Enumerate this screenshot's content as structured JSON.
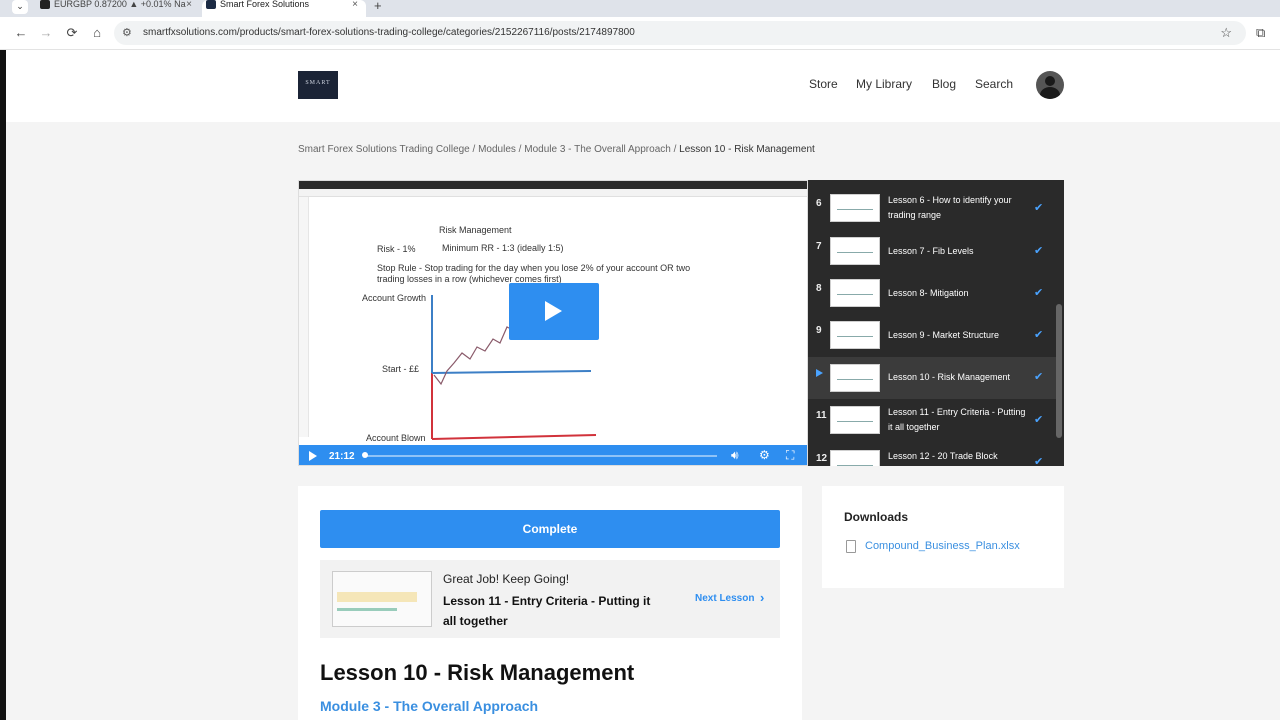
{
  "browser": {
    "tabs": [
      {
        "title": "EURGBP 0.87200 ▲ +0.01% Na",
        "active": false
      },
      {
        "title": "Smart Forex Solutions",
        "active": true
      }
    ],
    "new_tab": "+",
    "close_glyph": "×",
    "url": "smartfxsolutions.com/products/smart-forex-solutions-trading-college/categories/2152267116/posts/2174897800",
    "icons": {
      "back": "←",
      "forward": "→",
      "reload": "⟳",
      "home": "⌂",
      "site_info": "⚙",
      "bookmark": "☆",
      "extensions": "⧉",
      "tab_menu": "⌄"
    }
  },
  "header": {
    "logo_text": "SMART",
    "nav": [
      "Store",
      "My Library",
      "Blog",
      "Search"
    ]
  },
  "breadcrumb": {
    "items": [
      "Smart Forex Solutions Trading College",
      "Modules",
      "Module 3 - The Overall Approach"
    ],
    "separator": " / ",
    "current": "Lesson 10 - Risk Management"
  },
  "video": {
    "title": "Risk Management",
    "risk": "Risk - 1%",
    "min_rr": "Minimum RR - 1:3 (ideally 1:5)",
    "stop_rule_line1": "Stop Rule - Stop trading for the day when you lose 2% of your account OR two",
    "stop_rule_line2": "trading losses in a row (whichever comes first)",
    "label_growth": "Account Growth",
    "label_start": "Start - ££",
    "label_blown": "Account Blown",
    "time": "21:12",
    "progress": 0.0
  },
  "playlist": {
    "items": [
      {
        "num": "6",
        "title": "Lesson 6 - How to identify your trading range",
        "done": true,
        "active": false
      },
      {
        "num": "7",
        "title": "Lesson 7 - Fib Levels",
        "done": true,
        "active": false
      },
      {
        "num": "8",
        "title": "Lesson 8- Mitigation",
        "done": true,
        "active": false
      },
      {
        "num": "9",
        "title": "Lesson 9 - Market Structure",
        "done": true,
        "active": false
      },
      {
        "num": "",
        "title": "Lesson 10 - Risk Management",
        "done": true,
        "active": true
      },
      {
        "num": "11",
        "title": "Lesson 11 - Entry Criteria - Putting it all together",
        "done": true,
        "active": false
      },
      {
        "num": "12",
        "title": "Lesson 12 - 20 Trade Block",
        "done": true,
        "active": false
      }
    ],
    "check_glyph": "✔"
  },
  "main": {
    "complete_label": "Complete",
    "next_greeting": "Great Job! Keep Going!",
    "next_lesson_title": "Lesson 11 - Entry Criteria - Putting it all together",
    "next_link": "Next Lesson",
    "next_chevron": "›",
    "lesson_title": "Lesson 10 - Risk Management",
    "module_title": "Module 3 - The Overall Approach"
  },
  "downloads": {
    "title": "Downloads",
    "files": [
      "Compound_Business_Plan.xlsx"
    ]
  },
  "colors": {
    "accent": "#2e8ef0",
    "link": "#3a8fe0",
    "playlist_bg": "#2a2a2a"
  }
}
